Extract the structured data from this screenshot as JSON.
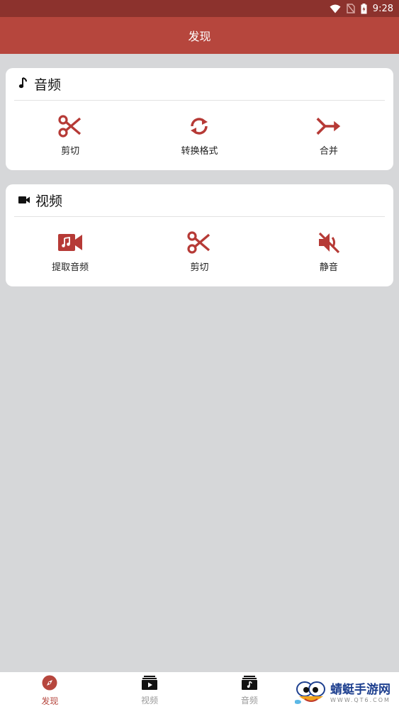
{
  "status_bar": {
    "time": "9:28",
    "icons": [
      "wifi-icon",
      "no-sim-icon",
      "battery-charging-icon"
    ]
  },
  "app_bar": {
    "title": "发现"
  },
  "audio_section": {
    "title": "音频",
    "icon": "music-note-icon",
    "items": [
      {
        "label": "剪切",
        "icon": "scissors-icon"
      },
      {
        "label": "转换格式",
        "icon": "convert-icon"
      },
      {
        "label": "合并",
        "icon": "merge-icon"
      }
    ]
  },
  "video_section": {
    "title": "视频",
    "icon": "video-camera-icon",
    "items": [
      {
        "label": "提取音频",
        "icon": "video-music-icon"
      },
      {
        "label": "剪切",
        "icon": "scissors-icon"
      },
      {
        "label": "静音",
        "icon": "mute-icon"
      }
    ]
  },
  "bottom_nav": {
    "items": [
      {
        "label": "发现",
        "icon": "compass-icon",
        "active": true
      },
      {
        "label": "视频",
        "icon": "video-folder-icon",
        "active": false
      },
      {
        "label": "音频",
        "icon": "audio-folder-icon",
        "active": false
      }
    ]
  },
  "watermark": {
    "text_cn": "蜻蜓手游网",
    "text_en": "WWW.QT6.COM"
  },
  "colors": {
    "primary": "#b6463d",
    "status_bar": "#8c322d",
    "background": "#d6d7d9",
    "accent_icon": "#b63a36"
  }
}
